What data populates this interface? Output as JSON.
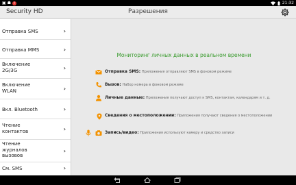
{
  "status_bar": {
    "time": "21:32"
  },
  "action_bar": {
    "app_title": "Security HD",
    "screen_title": "Разрешения"
  },
  "sidebar": {
    "items": [
      {
        "label": "Отправка SMS"
      },
      {
        "label": "Отправка MMS"
      },
      {
        "label": "Включение 2G/3G"
      },
      {
        "label": "Включение WLAN"
      },
      {
        "label": "Вкл. Bluetooth"
      },
      {
        "label": "Чтение контактов"
      },
      {
        "label": "Чтение журналов вызовов"
      },
      {
        "label": "См. SMS"
      }
    ]
  },
  "main": {
    "headline": "Мониторинг личных данных в реальном времени",
    "permissions": [
      {
        "title": "Отправка SMS:",
        "desc": "Приложения отправляют SMS в фоновом режиме"
      },
      {
        "title": "Вызов:",
        "desc": "Набор номера в фоновом режиме"
      },
      {
        "title": "Личные данные:",
        "desc": "Приложения получают доступ к SMS, контактам, календарям и т. д."
      },
      {
        "title": "Сведения о местоположении:",
        "desc": "Приложения получают сведения о местоположении"
      },
      {
        "title": "Запись/видео:",
        "desc": "Приложения используют камеру и средство записи"
      }
    ]
  },
  "colors": {
    "accent_green": "#3a9b2e",
    "icon_orange": "#f39200"
  }
}
